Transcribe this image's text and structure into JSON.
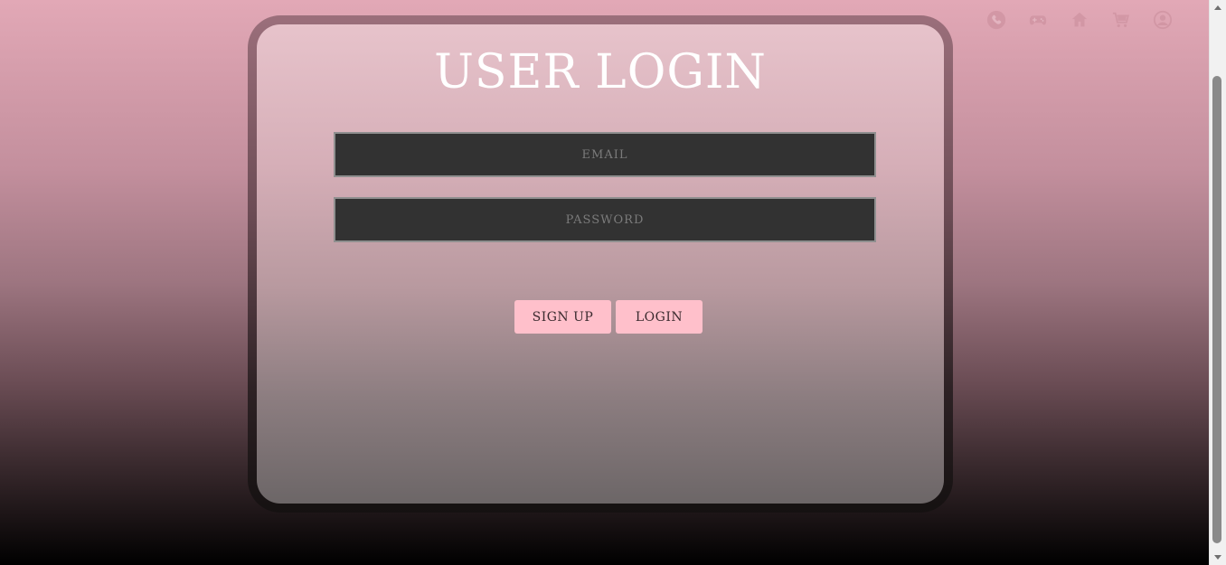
{
  "page": {
    "title": "USER LOGIN"
  },
  "nav": {
    "items": [
      {
        "name": "phone",
        "icon": "phone-icon"
      },
      {
        "name": "games",
        "icon": "gamepad-icon"
      },
      {
        "name": "home",
        "icon": "home-icon"
      },
      {
        "name": "cart",
        "icon": "cart-icon"
      },
      {
        "name": "account",
        "icon": "user-circle-icon"
      }
    ],
    "icon_color": "#c98c9a"
  },
  "form": {
    "email": {
      "value": "",
      "placeholder": "EMAIL"
    },
    "password": {
      "value": "",
      "placeholder": "PASSWORD"
    },
    "signup_label": "SIGN UP",
    "login_label": "LOGIN"
  },
  "colors": {
    "button_bg": "#ffc0cb",
    "input_bg": "#323232",
    "title": "#ffffff"
  }
}
